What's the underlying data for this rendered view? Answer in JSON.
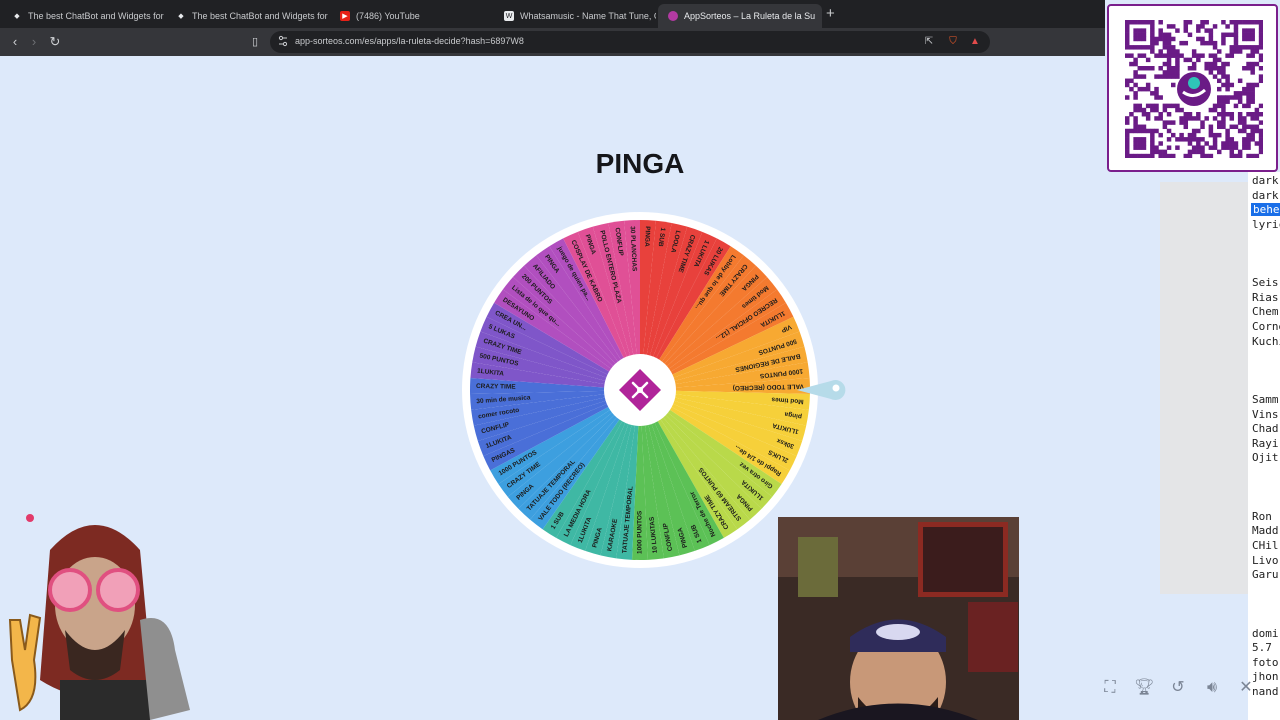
{
  "browser": {
    "tabs": [
      {
        "title": "The best ChatBot and Widgets for Ki",
        "fav": "kick-icon",
        "active": false
      },
      {
        "title": "The best ChatBot and Widgets for Ki",
        "fav": "kick-icon",
        "active": false
      },
      {
        "title": "(7486) YouTube",
        "fav": "youtube-icon",
        "active": false
      },
      {
        "title": "Whatsamusic - Name That Tune, Gu",
        "fav": "whatsamusic-icon",
        "active": false
      },
      {
        "title": "AppSorteos – La Ruleta de la Su",
        "fav": "appsorteos-icon",
        "active": true
      }
    ],
    "url": "app-sorteos.com/es/apps/la-ruleta-decide?hash=6897W8"
  },
  "wheel": {
    "title": "PINGA",
    "segments": [
      "PINGA",
      "1 SUB",
      "LOOLA",
      "CRAZY TIME",
      "1 LUKITA",
      "20 LUKAS",
      "Lobby de lo que qu...",
      "CRAZY TIME",
      "PINGA",
      "Mod times",
      "RECREO OFICIAL (12...",
      "1LUKITA",
      "VIP",
      "500 PUNTOS",
      "BAILE DE REGIONES",
      "1000 PUNTOS",
      "VALE TODO (RECREO)",
      "Mod times",
      "pinga",
      "1LUKITA",
      "30ksx",
      "2LUKS",
      "Rappi de 1/4 de...",
      "Giro otra vez",
      "1LUKITA",
      "PINGA",
      "STREAM 60 PUNTOS",
      "CRAZY TIME",
      "Noche de Terror",
      "1 SUB",
      "PINGA",
      "CONFLIP",
      "10 LUKITAS",
      "1000 PUNTOS",
      "TATUAJE TEMPORAL",
      "KARAOKE",
      "PINGA",
      "1LUKITA",
      "LA MEDIA HORA",
      "1 SUB",
      "VALE TODO (RECREO)",
      "TATUAJE TEMPORAL",
      "PINGA",
      "CRAZY TIME",
      "1000 PUNTOS",
      "PINGAS",
      "1LUKITA",
      "CONFLIP",
      "comer rocoto",
      "30 min de musica",
      "CRAZY TIME",
      "1LUKITA",
      "500 PUNTOS",
      "CRAZY TIME",
      "5 LUKAS",
      "CREA UN...",
      "DESAYUNO",
      "Lista de lo que qu...",
      "200 PUNTOS",
      "AFILIADO",
      "PINGA",
      "juego de quien pa...",
      "COSPLAY DE KABRO",
      "PINGA",
      "POLLO ENTERO PLAZA",
      "CONFLIP",
      "30 PLANCHAS"
    ],
    "colors": [
      "#e8413c",
      "#f47a2f",
      "#f7a932",
      "#f6d03a",
      "#b9d94a",
      "#5cc156",
      "#3fb8a4",
      "#3d9fdf",
      "#4a6fd8",
      "#7f56c9",
      "#b14fbf",
      "#e05096"
    ]
  },
  "right_panel": {
    "lines": [
      "dark",
      "dark",
      "behe",
      "lyric",
      "",
      "",
      "",
      "Seis",
      "Rias",
      "Chem",
      "Corne",
      "Kuchi",
      "",
      "",
      "",
      "Samm",
      "Vins",
      "Chad",
      "Rayi",
      "Ojit",
      "",
      "",
      "",
      "Ron",
      "Madd",
      "CHil",
      "Livo",
      "Garu",
      "",
      "",
      "",
      "domi",
      "5.7",
      "foto",
      "jhon",
      "nand"
    ],
    "selected_index": 2
  },
  "bottom_icons": [
    "fullscreen-icon",
    "trophy-icon",
    "undo-icon",
    "volume-icon",
    "close-icon"
  ]
}
